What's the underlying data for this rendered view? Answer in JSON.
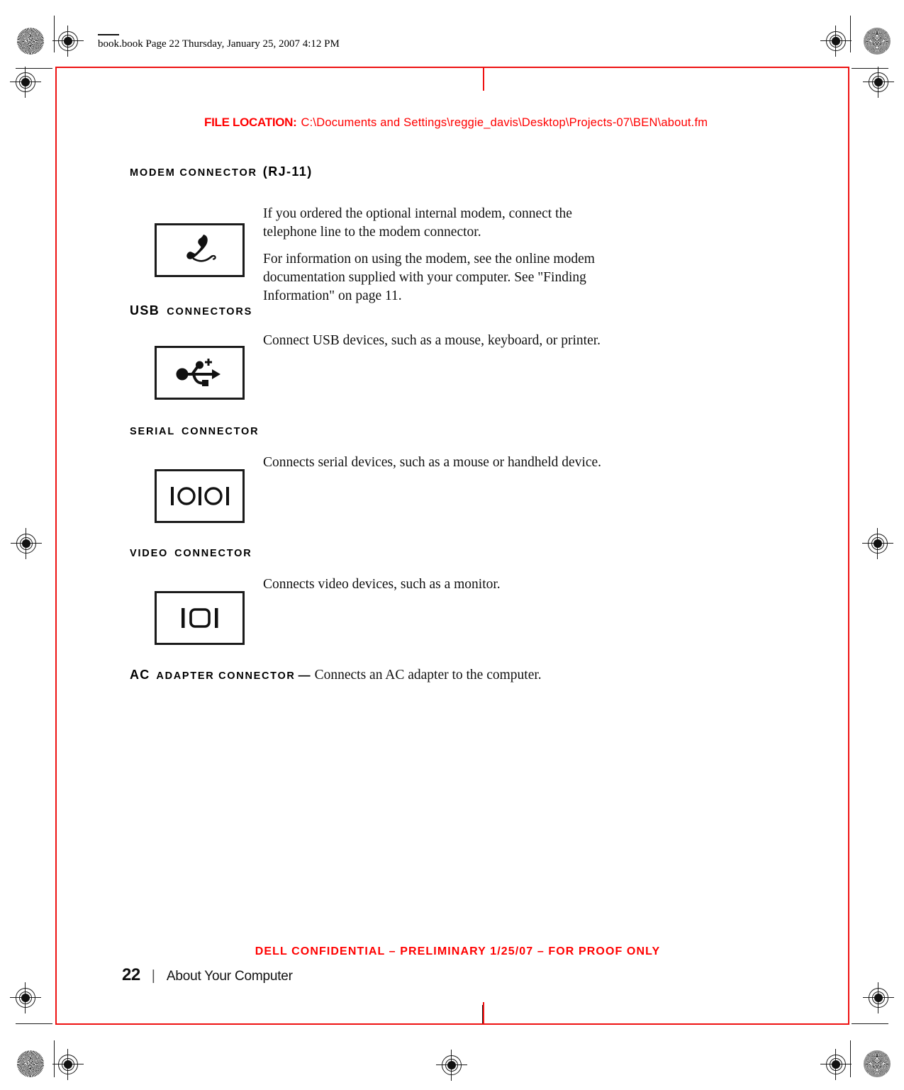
{
  "slug": {
    "text": "book.book  Page 22  Thursday, January 25, 2007  4:12 PM"
  },
  "file_location": {
    "label": "FILE LOCATION:",
    "path": "C:\\Documents and Settings\\reggie_davis\\Desktop\\Projects-07\\BEN\\about.fm",
    "color": "#ff0000"
  },
  "sections": [
    {
      "head_big": "MODEM CONNECTOR",
      "head_small": " (RJ-11)",
      "head_order": "small-first",
      "head_lead": "MODEM CONNECTOR",
      "head_trail": "(RJ-11)",
      "icon": "telephone-handset-icon",
      "paragraphs": [
        "If you ordered the optional internal modem, connect the telephone line to the modem connector.",
        "For information on using the modem, see the online modem documentation supplied with your computer. See \"Finding Information\" on page 11."
      ]
    },
    {
      "head_lead": "USB",
      "head_trail": "CONNECTORS",
      "icon": "usb-trident-icon",
      "paragraphs": [
        "Connect USB devices, such as a mouse, keyboard, or printer."
      ]
    },
    {
      "head_lead": "SERIAL",
      "head_trail": "CONNECTOR",
      "icon": "serial-port-icon",
      "paragraphs": [
        "Connects serial devices, such as a mouse or handheld device."
      ]
    },
    {
      "head_lead": "VIDEO",
      "head_trail": "CONNECTOR",
      "icon": "video-monitor-icon",
      "paragraphs": [
        "Connects video devices, such as a monitor."
      ]
    }
  ],
  "ac_adapter": {
    "term_big": "AC",
    "term_small": "ADAPTER CONNECTOR",
    "dash": "—",
    "description": "Connects an AC adapter to the computer."
  },
  "footer": {
    "confidential": "DELL CONFIDENTIAL – PRELIMINARY 1/25/07 – FOR PROOF ONLY",
    "page_number": "22",
    "separator": "|",
    "chapter": "About Your Computer",
    "confidential_color": "#ff0000"
  }
}
